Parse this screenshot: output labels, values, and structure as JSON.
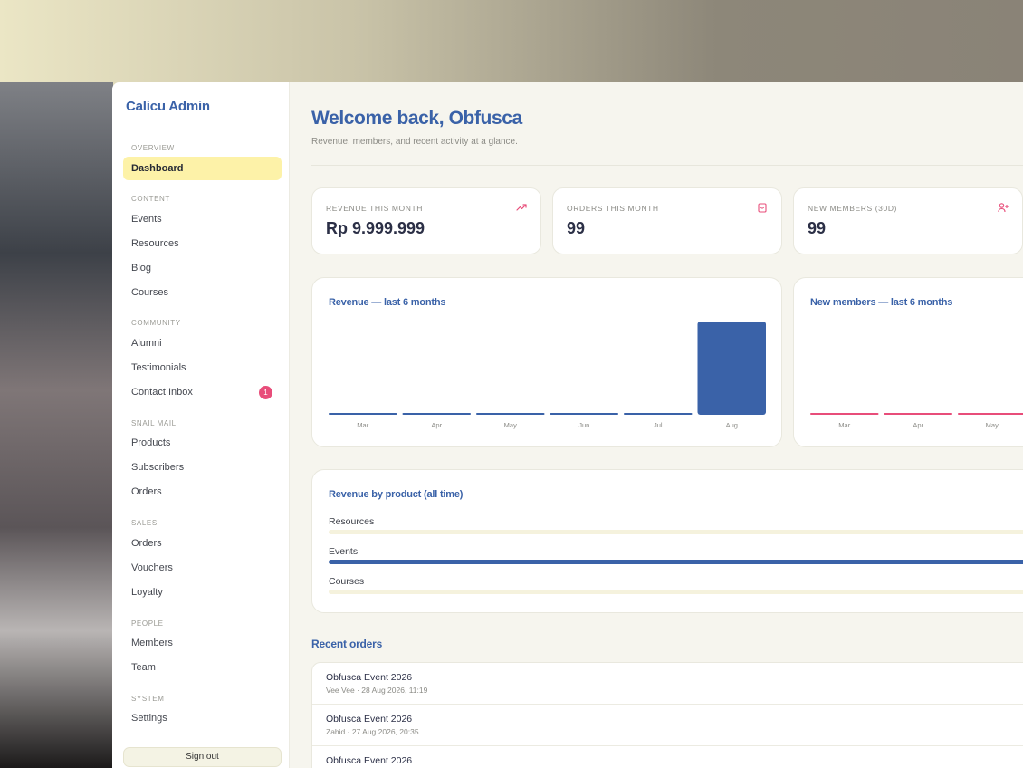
{
  "app": {
    "brand": "Calicu Admin"
  },
  "sidebar": {
    "sections": [
      {
        "label": "OVERVIEW",
        "items": [
          {
            "label": "Dashboard",
            "active": true
          }
        ]
      },
      {
        "label": "CONTENT",
        "items": [
          {
            "label": "Events"
          },
          {
            "label": "Resources"
          },
          {
            "label": "Blog"
          },
          {
            "label": "Courses"
          }
        ]
      },
      {
        "label": "COMMUNITY",
        "items": [
          {
            "label": "Alumni"
          },
          {
            "label": "Testimonials"
          },
          {
            "label": "Contact Inbox",
            "badge": "1"
          }
        ]
      },
      {
        "label": "SNAIL MAIL",
        "items": [
          {
            "label": "Products"
          },
          {
            "label": "Subscribers"
          },
          {
            "label": "Orders"
          }
        ]
      },
      {
        "label": "SALES",
        "items": [
          {
            "label": "Orders"
          },
          {
            "label": "Vouchers"
          },
          {
            "label": "Loyalty"
          }
        ]
      },
      {
        "label": "PEOPLE",
        "items": [
          {
            "label": "Members"
          },
          {
            "label": "Team"
          }
        ]
      },
      {
        "label": "SYSTEM",
        "items": [
          {
            "label": "Settings"
          }
        ]
      }
    ],
    "sign_out": "Sign out"
  },
  "header": {
    "title": "Welcome back, Obfusca",
    "subtitle": "Revenue, members, and recent activity at a glance."
  },
  "stats": [
    {
      "label": "REVENUE THIS MONTH",
      "value": "Rp 9.999.999",
      "icon": "trending-up-icon"
    },
    {
      "label": "ORDERS THIS MONTH",
      "value": "99",
      "icon": "shopping-bag-icon"
    },
    {
      "label": "NEW MEMBERS (30D)",
      "value": "99",
      "icon": "user-plus-icon"
    }
  ],
  "colors": {
    "accent": "#3a62a8",
    "pink": "#e84d7a",
    "active_bg": "#fdf2a8"
  },
  "chart_data": [
    {
      "type": "bar",
      "title": "Revenue — last 6 months",
      "categories": [
        "Mar",
        "Apr",
        "May",
        "Jun",
        "Jul",
        "Aug"
      ],
      "values": [
        0,
        0,
        0,
        0,
        0,
        9999999
      ],
      "color": "#3a62a8"
    },
    {
      "type": "bar",
      "title": "New members — last 6 months",
      "categories": [
        "Mar",
        "Apr",
        "May"
      ],
      "values": [
        0,
        0,
        0
      ],
      "color": "#e84d7a"
    },
    {
      "type": "bar",
      "title": "Revenue by product (all time)",
      "categories": [
        "Resources",
        "Events",
        "Courses"
      ],
      "values": [
        0,
        1,
        0
      ]
    }
  ],
  "recent_orders": {
    "title": "Recent orders",
    "rows": [
      {
        "name": "Obfusca Event 2026",
        "meta": "Vee Vee · 28 Aug 2026, 11:19"
      },
      {
        "name": "Obfusca Event 2026",
        "meta": "Zahid · 27 Aug 2026, 20:35"
      },
      {
        "name": "Obfusca Event 2026",
        "meta": ""
      }
    ]
  }
}
